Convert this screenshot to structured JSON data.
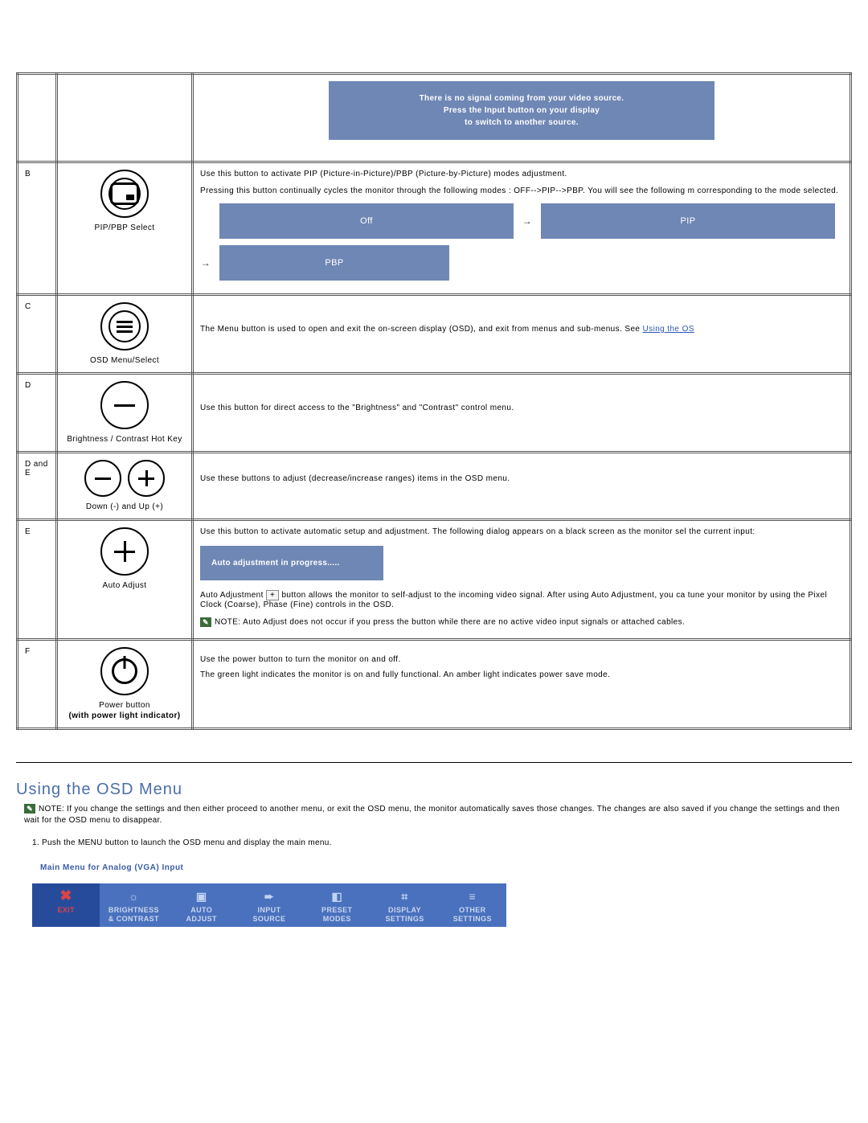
{
  "noSignal": {
    "l1": "There is no signal coming from your video source.",
    "l2": "Press the Input button on your display",
    "l3": "to switch to another source."
  },
  "rows": {
    "B": {
      "key": "B",
      "cap": "PIP/PBP Select",
      "p1": "Use this button to activate PIP (Picture-in-Picture)/PBP (Picture-by-Picture) modes adjustment.",
      "p2": "Pressing this button continually cycles the monitor through the following modes : OFF-->PIP-->PBP. You will see the following m corresponding to the mode selected.",
      "m_off": "Off",
      "m_pip": "PIP",
      "m_pbp": "PBP"
    },
    "C": {
      "key": "C",
      "cap": "OSD Menu/Select",
      "p1": "The Menu button is used to open and exit the on-screen display (OSD), and exit from menus and sub-menus. See ",
      "link": "Using the OS"
    },
    "D": {
      "key": "D",
      "cap": "Brightness / Contrast Hot Key",
      "p1": "Use this button for direct access to the \"Brightness\" and \"Contrast\" control menu."
    },
    "DE": {
      "key": "D and E",
      "cap": "Down (-) and Up (+)",
      "p1": "Use these buttons to adjust (decrease/increase ranges) items in the OSD menu."
    },
    "E": {
      "key": "E",
      "cap": "Auto Adjust",
      "p1": "Use this button to activate automatic setup and adjustment. The following dialog appears on a black screen as the monitor sel the current input:",
      "dlg": "Auto adjustment in progress.....",
      "p2a": "Auto Adjustment ",
      "p2b": " button allows the monitor to self-adjust to the incoming video signal. After using Auto Adjustment, you ca tune your monitor by using the Pixel Clock (Coarse), Phase (Fine) controls in the OSD.",
      "note": "NOTE: Auto Adjust does not occur if you press the button while there are no active video input signals or attached cables."
    },
    "F": {
      "key": "F",
      "cap1": "Power button",
      "cap2": "(with power light indicator)",
      "p1": "Use the power button to turn the monitor on and off.",
      "p2": "The green light indicates the monitor is on and fully functional. An amber light indicates power save mode."
    }
  },
  "osd": {
    "title": "Using the OSD Menu",
    "note": "NOTE: If you change the settings and then either proceed to another menu, or exit the OSD menu, the monitor automatically saves those changes. The changes are also saved if you change the settings and then wait for the OSD menu to disappear.",
    "step1": "1. Push the MENU button to launch the OSD menu and display the main menu.",
    "subhead": "Main Menu for Analog (VGA) Input",
    "tabs": {
      "exit": "EXIT",
      "bc1": "BRIGHTNESS",
      "bc2": "& CONTRAST",
      "aa1": "AUTO",
      "aa2": "ADJUST",
      "is1": "INPUT",
      "is2": "SOURCE",
      "pm1": "PRESET",
      "pm2": "MODES",
      "ds1": "DISPLAY",
      "ds2": "SETTINGS",
      "os1": "OTHER",
      "os2": "SETTINGS"
    }
  }
}
